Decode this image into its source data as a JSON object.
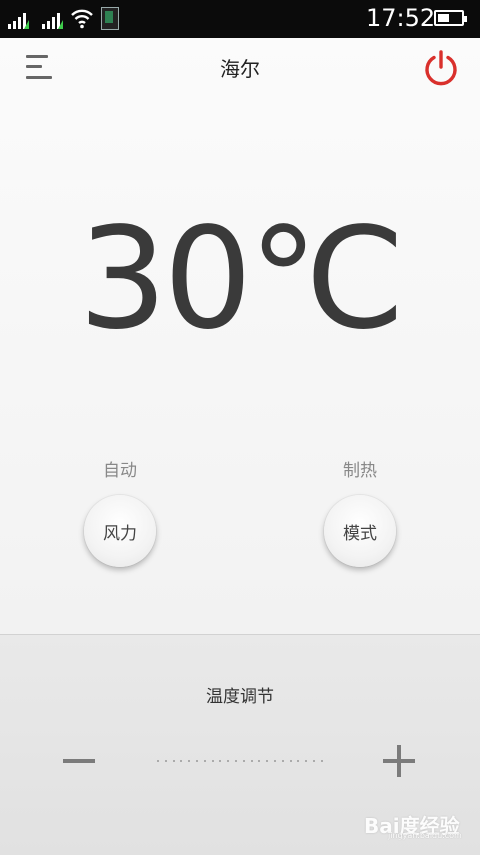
{
  "status_bar": {
    "time": "17:52",
    "battery_level": 0.5
  },
  "header": {
    "title": "海尔",
    "menu_icon": "menu-icon",
    "power_icon": "power-icon",
    "power_color": "#d9302c"
  },
  "temperature": {
    "display": "30℃"
  },
  "controls": {
    "wind": {
      "status": "自动",
      "button_label": "风力"
    },
    "mode": {
      "status": "制热",
      "button_label": "模式"
    }
  },
  "adjust": {
    "title": "温度调节",
    "minus_icon": "minus-icon",
    "plus_icon": "plus-icon"
  },
  "watermark": {
    "text": "Bai度经验",
    "url": "jingyan.baidu.com"
  }
}
